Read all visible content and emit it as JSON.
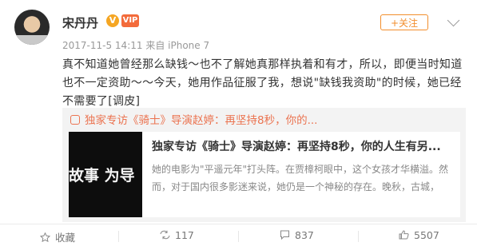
{
  "post": {
    "username": "宋丹丹",
    "badge_v": "V",
    "badge_vip": "VIP",
    "timestamp": "2017-11-5 14:11",
    "source": "来自 iPhone 7",
    "follow_label": "+关注",
    "text": "真不知道她曾经那么缺钱～也不了解她真那样执着和有才，所以，即便当时知道也不一定资助～～今天，她用作品征服了我，想说\"缺钱我资助\"的时候，她已经不需要了[调皮]"
  },
  "card": {
    "link_text": "独家专访《骑士》导演赵婷：再坚持8秒，你的...",
    "thumb_text": "故事 为导",
    "title": "独家专访《骑士》导演赵婷：再坚持8秒，你的人生有另...",
    "description": "她的电影为\"平遥元年\"打头阵。在贾樟柯眼中，这个女孩才华横溢。然而，对于国内很多影迷来说，她仍是一个神秘的存在。晚秋，古城，"
  },
  "actions": {
    "favorite_label": "收藏",
    "repost_count": "117",
    "comment_count": "837",
    "like_count": "5507"
  },
  "colors": {
    "accent": "#f28e2c",
    "link": "#eb7350"
  }
}
